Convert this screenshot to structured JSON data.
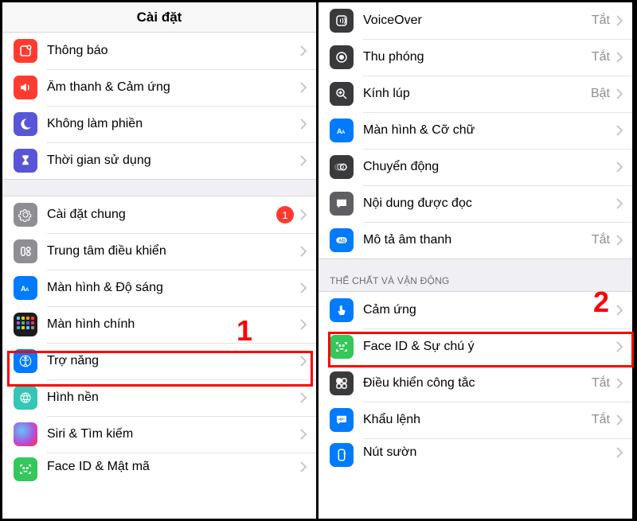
{
  "left": {
    "title": "Cài đặt",
    "groups": [
      {
        "items": [
          {
            "name": "thong-bao",
            "iconColor": "red",
            "label": "Thông báo"
          },
          {
            "name": "am-thanh",
            "iconColor": "red",
            "label": "Âm thanh & Cảm ứng"
          },
          {
            "name": "khong-lam-phien",
            "iconColor": "purple",
            "label": "Không làm phiền"
          },
          {
            "name": "thoi-gian-su-dung",
            "iconColor": "purple",
            "label": "Thời gian sử dụng"
          }
        ]
      },
      {
        "items": [
          {
            "name": "cai-dat-chung",
            "iconColor": "gray",
            "label": "Cài đặt chung",
            "badge": "1"
          },
          {
            "name": "trung-tam-dieu-khien",
            "iconColor": "gray",
            "label": "Trung tâm điều khiển"
          },
          {
            "name": "man-hinh-do-sang",
            "iconColor": "blue",
            "label": "Màn hình & Độ sáng"
          },
          {
            "name": "man-hinh-chinh",
            "iconColor": "home",
            "label": "Màn hình chính"
          },
          {
            "name": "tro-nang",
            "iconColor": "blue",
            "label": "Trợ năng"
          },
          {
            "name": "hinh-nen",
            "iconColor": "teal",
            "label": "Hình nền"
          },
          {
            "name": "siri",
            "iconColor": "siri",
            "label": "Siri & Tìm kiếm"
          },
          {
            "name": "face-id-matma",
            "iconColor": "green",
            "label": "Face ID & Mật mã"
          }
        ]
      }
    ]
  },
  "right": {
    "groups": [
      {
        "items": [
          {
            "name": "voiceover",
            "iconColor": "black",
            "label": "VoiceOver",
            "detail": "Tắt"
          },
          {
            "name": "thu-phong",
            "iconColor": "black",
            "label": "Thu phóng",
            "detail": "Tắt"
          },
          {
            "name": "kinh-lup",
            "iconColor": "black",
            "label": "Kính lúp",
            "detail": "Bật"
          },
          {
            "name": "man-hinh-co-chu",
            "iconColor": "blue",
            "label": "Màn hình & Cỡ chữ"
          },
          {
            "name": "chuyen-dong",
            "iconColor": "black",
            "label": "Chuyển động"
          },
          {
            "name": "noi-dung-doc",
            "iconColor": "darkgray",
            "label": "Nội dung được đọc"
          },
          {
            "name": "mo-ta-am-thanh",
            "iconColor": "blue",
            "label": "Mô tả âm thanh",
            "detail": "Tắt"
          }
        ]
      },
      {
        "header": "THỂ CHẤT VÀ VẬN ĐỘNG",
        "items": [
          {
            "name": "cam-ung",
            "iconColor": "blue",
            "label": "Cảm ứng"
          },
          {
            "name": "face-id-chu-y",
            "iconColor": "green",
            "label": "Face ID & Sự chú ý"
          },
          {
            "name": "dieu-khien-cong-tac",
            "iconColor": "black",
            "label": "Điều khiển công tắc",
            "detail": "Tắt"
          },
          {
            "name": "khau-lenh",
            "iconColor": "blue",
            "label": "Khẩu lệnh",
            "detail": "Tắt"
          },
          {
            "name": "nut-suon",
            "iconColor": "blue",
            "label": "Nút sườn"
          }
        ]
      }
    ]
  },
  "annotations": {
    "step1": "1",
    "step2": "2"
  }
}
